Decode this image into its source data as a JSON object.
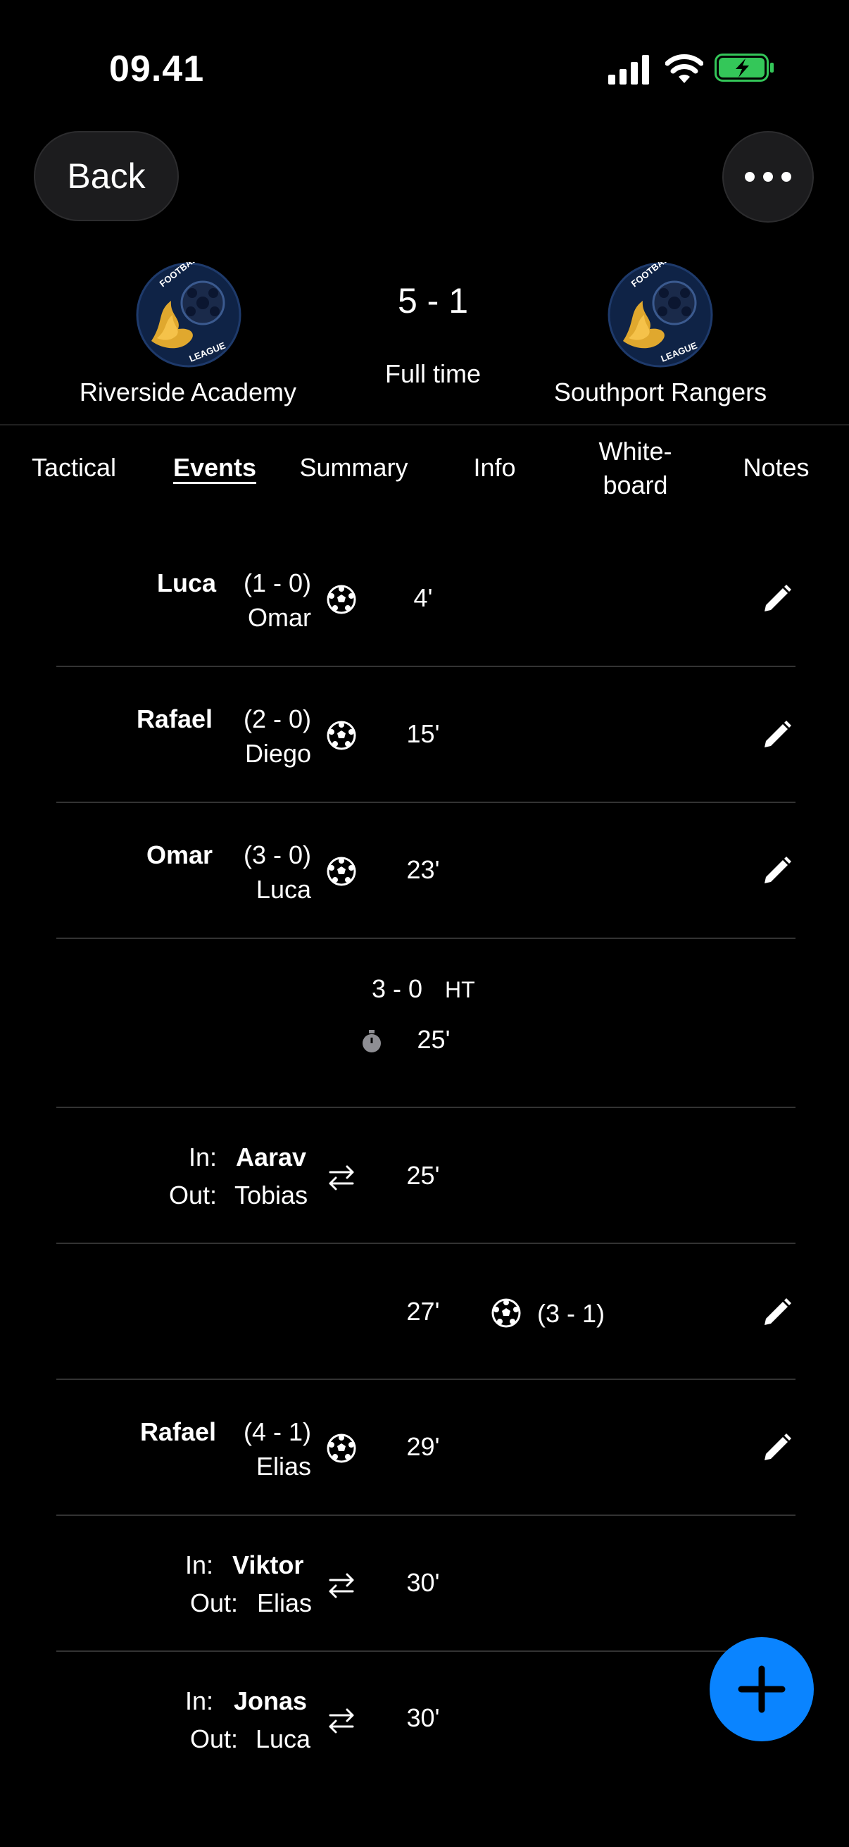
{
  "status_bar": {
    "time": "09.41"
  },
  "header": {
    "back_label": "Back"
  },
  "match": {
    "home_team": "Riverside Academy",
    "away_team": "Southport Rangers",
    "score": "5 - 1",
    "status": "Full time",
    "logo_text_top": "FOOTBALL",
    "logo_text_bottom": "LEAGUE"
  },
  "tabs": [
    {
      "label": "Tactical"
    },
    {
      "label": "Events"
    },
    {
      "label": "Summary"
    },
    {
      "label": "Info"
    },
    {
      "label": "White-",
      "label2": "board"
    },
    {
      "label": "Notes"
    }
  ],
  "events": {
    "e1": {
      "scorer": "Luca",
      "score": "(1 - 0)",
      "assist": "Omar",
      "minute": "4'"
    },
    "e2": {
      "scorer": "Rafael",
      "score": "(2 - 0)",
      "assist": "Diego",
      "minute": "15'"
    },
    "e3": {
      "scorer": "Omar",
      "score": "(3 - 0)",
      "assist": "Luca",
      "minute": "23'"
    },
    "ht": {
      "score": "3 - 0",
      "label": "HT",
      "minute": "25'"
    },
    "s1": {
      "in_label": "In:",
      "in_player": "Aarav",
      "out_label": "Out:",
      "out_player": "Tobias",
      "minute": "25'"
    },
    "e4": {
      "minute": "27'",
      "score": "(3 - 1)"
    },
    "e5": {
      "scorer": "Rafael",
      "score": "(4 - 1)",
      "assist": "Elias",
      "minute": "29'"
    },
    "s2": {
      "in_label": "In:",
      "in_player": "Viktor",
      "out_label": "Out:",
      "out_player": "Elias",
      "minute": "30'"
    },
    "s3": {
      "in_label": "In:",
      "in_player": "Jonas",
      "out_label": "Out:",
      "out_player": "Luca",
      "minute": "30'"
    }
  },
  "colors": {
    "accent": "#0a84ff",
    "battery": "#34c759",
    "logo_bg": "#0f2346",
    "logo_flame": "#e0a82e"
  }
}
